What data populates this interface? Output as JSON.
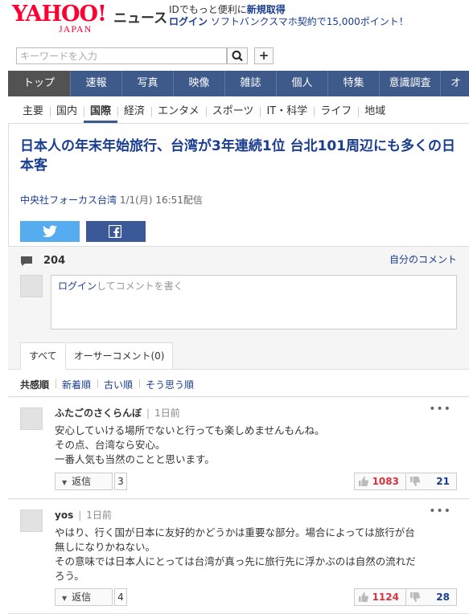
{
  "header": {
    "logo_main": "YAHOO!",
    "logo_sub": "JAPAN",
    "section_label": "ニュース",
    "promo_line1_a": "IDでもっと便利に",
    "promo_line1_b": "新規取得",
    "promo_line2_a": "ログイン",
    "promo_line2_b": "ソフトバンクスマホ契約で15,000ポイント！"
  },
  "search": {
    "placeholder": "キーワードを入力",
    "plus_label": "+"
  },
  "nav_primary": [
    "トップ",
    "速報",
    "写真",
    "映像",
    "雑誌",
    "個人",
    "特集",
    "意識調査",
    "オ"
  ],
  "nav_secondary": [
    "主要",
    "国内",
    "国際",
    "経済",
    "エンタメ",
    "スポーツ",
    "IT・科学",
    "ライフ",
    "地域"
  ],
  "article": {
    "title": "日本人の年末年始旅行、台湾が3年連続1位 台北101周辺にも多くの日本客",
    "source": "中央社フォーカス台湾",
    "date": "1/1(月) 16:51配信"
  },
  "comments": {
    "count": "204",
    "my_comments": "自分のコメント",
    "input_link": "ログイン",
    "input_rest": "してコメントを書く",
    "tabs": [
      "すべて",
      "オーサーコメント(0)"
    ],
    "sort": [
      "共感順",
      "新着順",
      "古い順",
      "そう思う順"
    ],
    "reply_label": "返信",
    "items": [
      {
        "name": "ふたごのさくらんぼ",
        "time": "1日前",
        "lines": [
          "安心していける場所でないと行っても楽しめませんもんね。",
          "その点、台湾なら安心。",
          "一番人気も当然のことと思います。"
        ],
        "replies": "3",
        "likes": "1083",
        "dislikes": "21"
      },
      {
        "name": "yos",
        "time": "1日前",
        "lines": [
          "やはり、行く国が日本に友好的かどうかは重要な部分。場合によっては旅行が台",
          "無しになりかねない。",
          "その意味では日本人にとっては台湾が真っ先に旅行先に浮かぶのは自然の流れだ",
          "ろう。"
        ],
        "replies": "4",
        "likes": "1124",
        "dislikes": "28"
      }
    ]
  },
  "colors": {
    "brand_red": "#ff0033",
    "nav_blue": "#3d5a8a",
    "link_blue": "#1a3d8f",
    "twitter": "#55acee",
    "facebook": "#3b5998",
    "like_red": "#d9333f"
  }
}
